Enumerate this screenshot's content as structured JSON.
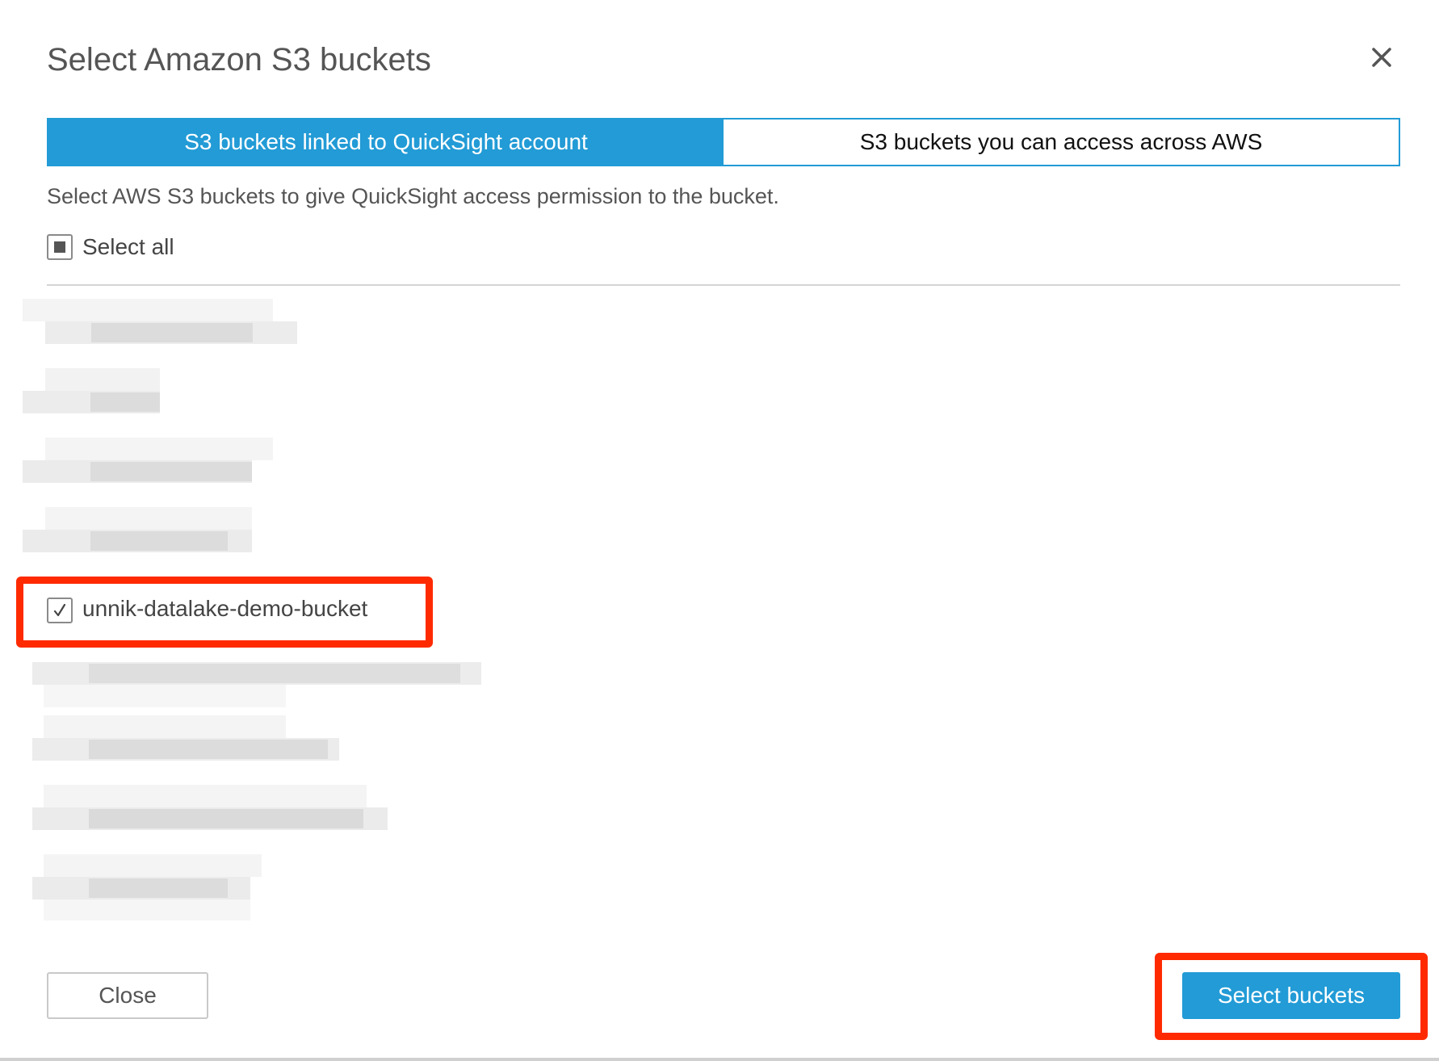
{
  "dialog": {
    "title": "Select Amazon S3 buckets",
    "close_icon": "close-icon",
    "tabs": [
      {
        "label": "S3 buckets linked to QuickSight account",
        "active": true
      },
      {
        "label": "S3 buckets you can access across AWS",
        "active": false
      }
    ],
    "description": "Select AWS S3 buckets to give QuickSight access permission to the bucket.",
    "select_all": {
      "label": "Select all",
      "state": "indeterminate"
    },
    "buckets": [
      {
        "label": "unnik-datalake-demo-bucket",
        "checked": true,
        "highlighted": true
      }
    ],
    "footer": {
      "close_label": "Close",
      "primary_label": "Select buckets"
    }
  },
  "colors": {
    "accent": "#229bd6",
    "highlight": "#ff2a00",
    "text": "#555555"
  }
}
